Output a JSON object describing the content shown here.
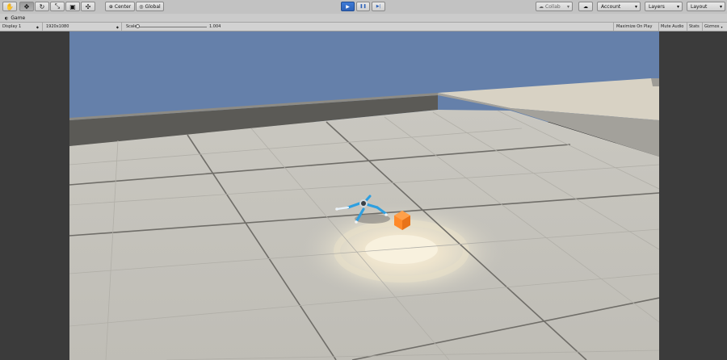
{
  "toolbar": {
    "transform_tools": [
      {
        "name": "hand-tool",
        "glyph": "✋"
      },
      {
        "name": "move-tool",
        "glyph": "✥"
      },
      {
        "name": "rotate-tool",
        "glyph": "↻"
      },
      {
        "name": "scale-tool",
        "glyph": "⤡"
      },
      {
        "name": "rect-tool",
        "glyph": "▣"
      },
      {
        "name": "transform-tool",
        "glyph": "✣"
      }
    ],
    "pivot_label": "Center",
    "space_label": "Global",
    "play_glyph": "▶",
    "pause_glyph": "❚❚",
    "step_glyph": "▶|",
    "collab_label": "Collab",
    "account_label": "Account",
    "layers_label": "Layers",
    "layout_label": "Layout",
    "dropdown_glyph": "▾"
  },
  "tab": {
    "label": "Game"
  },
  "game_bar": {
    "display": "Display 1",
    "resolution": "1920x1080",
    "scale_label": "Scale",
    "scale_value": "1.004",
    "maximize_on_play": "Maximize On Play",
    "mute_audio": "Mute Audio",
    "stats": "Stats",
    "gizmos": "Gizmos"
  },
  "colors": {
    "sky": "#6580aa",
    "floor": "#c4c2bb",
    "wall": "#5b5a56",
    "cube": "#ff8a2a",
    "agent": "#2e9fe0",
    "play_active": "#2f63b8"
  }
}
